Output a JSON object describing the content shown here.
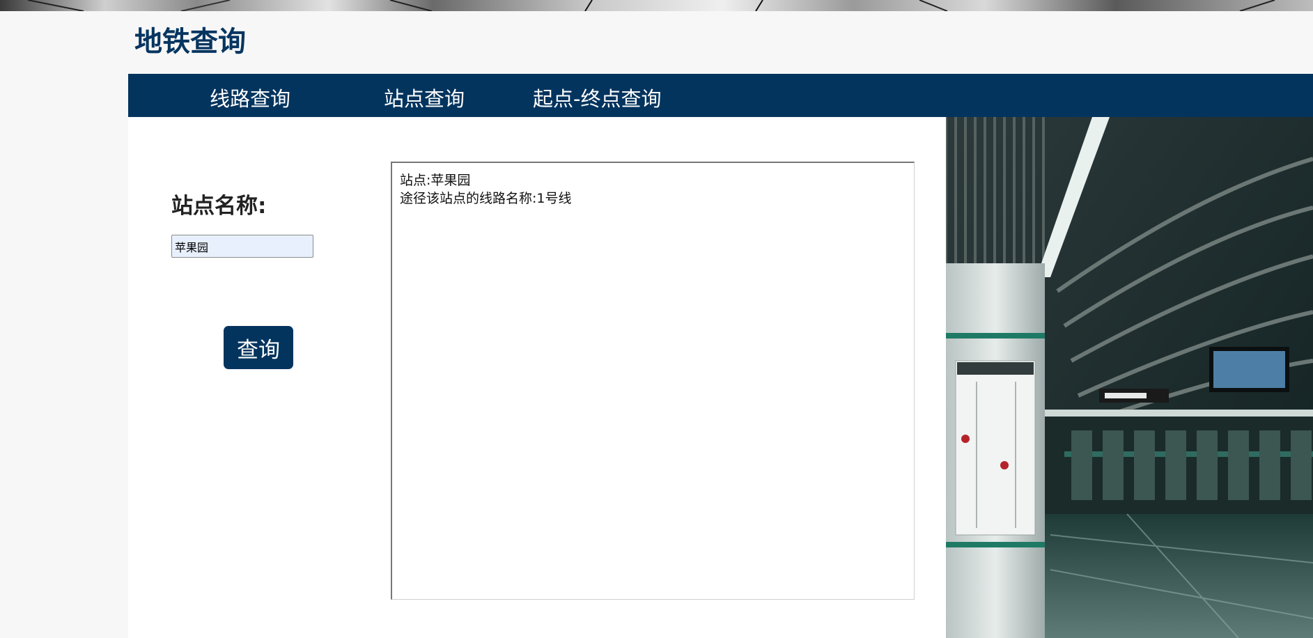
{
  "app": {
    "title": "地铁查询"
  },
  "nav": {
    "items": [
      {
        "label": "线路查询"
      },
      {
        "label": "站点查询"
      },
      {
        "label": "起点-终点查询"
      }
    ]
  },
  "form": {
    "label": "站点名称:",
    "station_value": "苹果园",
    "button_label": "查询"
  },
  "result": {
    "lines": [
      "站点:苹果园",
      "途径该站点的线路名称:1号线"
    ]
  },
  "colors": {
    "brand": "#03345e",
    "title": "#063560",
    "input_bg": "#e8f0fe"
  }
}
